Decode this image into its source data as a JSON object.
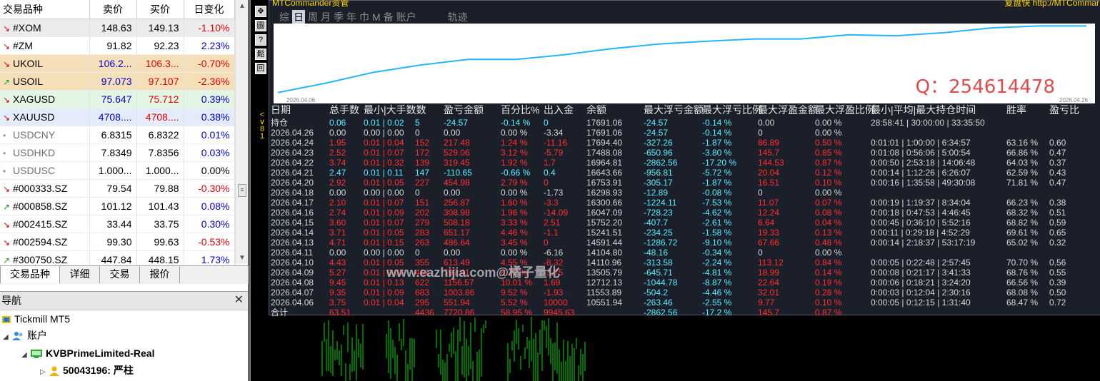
{
  "market_watch": {
    "headers": {
      "symbol": "交易品种",
      "bid": "卖价",
      "ask": "买价",
      "change": "日变化"
    },
    "rows": [
      {
        "symbol": "#XOM",
        "bid": "148.63",
        "ask": "149.13",
        "change": "-1.10%",
        "dir": "down"
      },
      {
        "symbol": "#ZM",
        "bid": "91.82",
        "ask": "92.23",
        "change": "2.23%",
        "dir": "down"
      },
      {
        "symbol": "UKOIL",
        "bid": "106.2...",
        "ask": "106.3...",
        "change": "-0.70%",
        "dir": "down"
      },
      {
        "symbol": "USOIL",
        "bid": "97.073",
        "ask": "97.107",
        "change": "-2.36%",
        "dir": "up"
      },
      {
        "symbol": "XAGUSD",
        "bid": "75.647",
        "ask": "75.712",
        "change": "0.39%",
        "dir": "down"
      },
      {
        "symbol": "XAUUSD",
        "bid": "4708....",
        "ask": "4708....",
        "change": "0.38%",
        "dir": "down"
      },
      {
        "symbol": "USDCNY",
        "bid": "6.8315",
        "ask": "6.8322",
        "change": "0.01%",
        "dir": "dot"
      },
      {
        "symbol": "USDHKD",
        "bid": "7.8349",
        "ask": "7.8356",
        "change": "0.03%",
        "dir": "dot"
      },
      {
        "symbol": "USDUSC",
        "bid": "1.000...",
        "ask": "1.000...",
        "change": "0.00%",
        "dir": "dot"
      },
      {
        "symbol": "#000333.SZ",
        "bid": "79.54",
        "ask": "79.88",
        "change": "-0.30%",
        "dir": "down"
      },
      {
        "symbol": "#000858.SZ",
        "bid": "101.12",
        "ask": "101.43",
        "change": "0.08%",
        "dir": "up"
      },
      {
        "symbol": "#002415.SZ",
        "bid": "33.44",
        "ask": "33.75",
        "change": "0.30%",
        "dir": "down"
      },
      {
        "symbol": "#002594.SZ",
        "bid": "99.30",
        "ask": "99.63",
        "change": "-0.53%",
        "dir": "down"
      },
      {
        "symbol": "#300750.SZ",
        "bid": "447.84",
        "ask": "448.15",
        "change": "1.73%",
        "dir": "up"
      }
    ],
    "tabs": [
      "交易品种",
      "详细",
      "交易",
      "报价"
    ]
  },
  "navigator": {
    "title": "导航",
    "broker": "Tickmill MT5",
    "accounts_label": "账户",
    "server": "KVBPrimeLimited-Real",
    "account": "50043196: 严柱"
  },
  "panel": {
    "title": "MTCommander资管",
    "right_text": "复盘快 http://MTCommar",
    "period_tabs": [
      "综",
      "日",
      "周",
      "月",
      "季",
      "年",
      "巾",
      "M",
      "备",
      "账户",
      "轨迹"
    ],
    "selected_tab": "日",
    "watermark": "www.eazhijia.com@橘子量化",
    "qq": "Q：254614478",
    "chart_dates": {
      "start": "2026.04.06",
      "end": "2026.04.26"
    },
    "columns": [
      "日期",
      "总手数",
      "最小|大手数数",
      "盈亏金额",
      "百分比%",
      "出入金",
      "余额",
      "最大浮亏金额",
      "最大浮亏比例",
      "最大浮盈金额",
      "最大浮盈比例",
      "最小|平均|最大持仓时间",
      "胜率",
      "盈亏比"
    ],
    "rows": [
      [
        "持仓",
        "0.06",
        "0.01 | 0.02",
        "5",
        "-24.57",
        "-0.14 %",
        "0",
        "17691.06",
        "-24.57",
        "-0.14 %",
        "0.00",
        "0.00 %",
        "28:58:41 | 30:00:00 | 33:35:50",
        "",
        ""
      ],
      [
        "2026.04.26",
        "0.00",
        "0.00 | 0.00",
        "0",
        "0.00",
        "0.00 %",
        "-3.34",
        "17691.06",
        "-24.57",
        "-0.14 %",
        "0",
        "0.00 %",
        "",
        "",
        ""
      ],
      [
        "2026.04.24",
        "1.95",
        "0.01 | 0.04",
        "152",
        "217.48",
        "1.24 %",
        "-11.16",
        "17694.40",
        "-327.26",
        "-1.87 %",
        "86.89",
        "0.50 %",
        "0:01:01 | 1:00:00 | 6:34:57",
        "63.16 %",
        "0.60"
      ],
      [
        "2026.04.23",
        "2.52",
        "0.01 | 0.07",
        "172",
        "529.06",
        "3.12 %",
        "-5.79",
        "17488.08",
        "-650.96",
        "-3.80 %",
        "145.7",
        "0.85 %",
        "0:01:08 | 0:56:06 | 5:00:54",
        "66.86 %",
        "0.47"
      ],
      [
        "2026.04.22",
        "3.74",
        "0.01 | 0.32",
        "139",
        "319.45",
        "1.92 %",
        "1.7",
        "16964.81",
        "-2862.56",
        "-17.20 %",
        "144.53",
        "0.87 %",
        "0:00:50 | 2:53:18 | 14:06:48",
        "64.03 %",
        "0.37"
      ],
      [
        "2026.04.21",
        "2.47",
        "0.01 | 0.11",
        "147",
        "-110.65",
        "-0.66 %",
        "0.4",
        "16643.66",
        "-956.81",
        "-5.72 %",
        "20.04",
        "0.12 %",
        "0:00:14 | 1:12:26 | 6:26:07",
        "62.59 %",
        "0.43"
      ],
      [
        "2026.04.20",
        "2.92",
        "0.01 | 0.05",
        "227",
        "454.98",
        "2.79 %",
        "0",
        "16753.91",
        "-305.17",
        "-1.87 %",
        "16.51",
        "0.10 %",
        "0:00:16 | 1:35:58 | 49:30:08",
        "71.81 %",
        "0.47"
      ],
      [
        "2026.04.18",
        "0.00",
        "0.00 | 0.00",
        "0",
        "0.00",
        "0.00 %",
        "-1.73",
        "16298.93",
        "-12.89",
        "-0.08 %",
        "0",
        "0.00 %",
        "",
        "",
        ""
      ],
      [
        "2026.04.17",
        "2.10",
        "0.01 | 0.07",
        "151",
        "256.87",
        "1.60 %",
        "-3.3",
        "16300.66",
        "-1224.11",
        "-7.53 %",
        "11.07",
        "0.07 %",
        "0:00:19 | 1:19:37 | 8:34:04",
        "66.23 %",
        "0.38"
      ],
      [
        "2026.04.16",
        "2.74",
        "0.01 | 0.09",
        "202",
        "308.98",
        "1.96 %",
        "-14.09",
        "16047.09",
        "-728.23",
        "-4.62 %",
        "12.24",
        "0.08 %",
        "0:00:18 | 0:47:53 | 4:46:45",
        "68.32 %",
        "0.51"
      ],
      [
        "2026.04.15",
        "3.60",
        "0.01 | 0.07",
        "279",
        "508.18",
        "3.33 %",
        "2.51",
        "15752.20",
        "-407.7",
        "-2.61 %",
        "6.64",
        "0.04 %",
        "0:00:45 | 0:36:10 | 5:52:16",
        "68.82 %",
        "0.59"
      ],
      [
        "2026.04.14",
        "3.71",
        "0.01 | 0.05",
        "283",
        "651.17",
        "4.46 %",
        "-1.1",
        "15241.51",
        "-234.25",
        "-1.58 %",
        "19.33",
        "0.13 %",
        "0:00:11 | 0:29:18 | 4:52:29",
        "69.61 %",
        "0.65"
      ],
      [
        "2026.04.13",
        "4.71",
        "0.01 | 0.15",
        "263",
        "486.64",
        "3.45 %",
        "0",
        "14591.44",
        "-1286.72",
        "-9.10 %",
        "67.66",
        "0.48 %",
        "0:00:14 | 2:18:37 | 53:17:19",
        "65.02 %",
        "0.32"
      ],
      [
        "2026.04.11",
        "0.00",
        "0.00 | 0.00",
        "0",
        "0.00",
        "0.00 %",
        "-6.16",
        "14104.80",
        "-48.16",
        "-0.34 %",
        "0",
        "0.00 %",
        "",
        "",
        ""
      ],
      [
        "2026.04.10",
        "4.43",
        "0.01 | 0.05",
        "355",
        "613.49",
        "4.55 %",
        "-8.32",
        "14110.96",
        "-313.58",
        "-2.24 %",
        "113.12",
        "0.84 %",
        "0:00:05 | 0:22:48 | 2:57:45",
        "70.70 %",
        "0.56"
      ],
      [
        "2026.04.09",
        "5.27",
        "0.01 | 0.07",
        "461",
        "797.41",
        "6.27 %",
        "-3.75",
        "13505.79",
        "-645.71",
        "-4.81 %",
        "18.99",
        "0.14 %",
        "0:00:08 | 0:21:17 | 3:41:33",
        "68.76 %",
        "0.55"
      ],
      [
        "2026.04.08",
        "9.45",
        "0.01 | 0.13",
        "622",
        "1156.57",
        "10.01 %",
        "1.69",
        "12712.13",
        "-1044.78",
        "-8.87 %",
        "22.64",
        "0.19 %",
        "0:00:06 | 0:18:21 | 3:24:20",
        "66.56 %",
        "0.39"
      ],
      [
        "2026.04.07",
        "9.35",
        "0.01 | 0.09",
        "683",
        "1003.86",
        "9.52 %",
        "-1.93",
        "11553.89",
        "-504.2",
        "-4.46 %",
        "32.01",
        "0.28 %",
        "0:00:03 | 0:12:04 | 2:30:16",
        "68.08 %",
        "0.50"
      ],
      [
        "2026.04.06",
        "3.75",
        "0.01 | 0.04",
        "295",
        "551.94",
        "5.52 %",
        "10000",
        "10551.94",
        "-263.46",
        "-2.55 %",
        "9.77",
        "0.10 %",
        "0:00:05 | 0:12:15 | 1:31:40",
        "68.47 %",
        "0.72"
      ],
      [
        "合计",
        "63.51",
        "",
        "4436",
        "7720.86",
        "58.95 %",
        "9945.63",
        "",
        "-2862.56",
        "-17.2 %",
        "145.7",
        "0.87 %",
        "",
        "",
        ""
      ]
    ]
  },
  "chart_data": {
    "type": "line",
    "title": "",
    "x": [
      "2026.04.06",
      "2026.04.07",
      "2026.04.08",
      "2026.04.09",
      "2026.04.10",
      "2026.04.11",
      "2026.04.13",
      "2026.04.14",
      "2026.04.15",
      "2026.04.16",
      "2026.04.17",
      "2026.04.18",
      "2026.04.20",
      "2026.04.21",
      "2026.04.22",
      "2026.04.23",
      "2026.04.24",
      "2026.04.26"
    ],
    "series": [
      {
        "values": [
          10551.94,
          11553.89,
          12712.13,
          13505.79,
          14110.96,
          14104.8,
          14591.44,
          15241.51,
          15752.2,
          16047.09,
          16300.66,
          16298.93,
          16753.91,
          16643.66,
          16964.81,
          17488.08,
          17694.4,
          17691.06
        ]
      }
    ],
    "grid": false
  },
  "colors": {
    "row_xom": "#ececec",
    "row_oil": "#f5dfb8",
    "row_xag": "#e3f5e3",
    "row_xau": "#e4ecfa",
    "up": "#0000cc",
    "down": "#e00000",
    "line": "#26b4ff",
    "cyan": "#5af0ff",
    "red": "#ff3030"
  }
}
